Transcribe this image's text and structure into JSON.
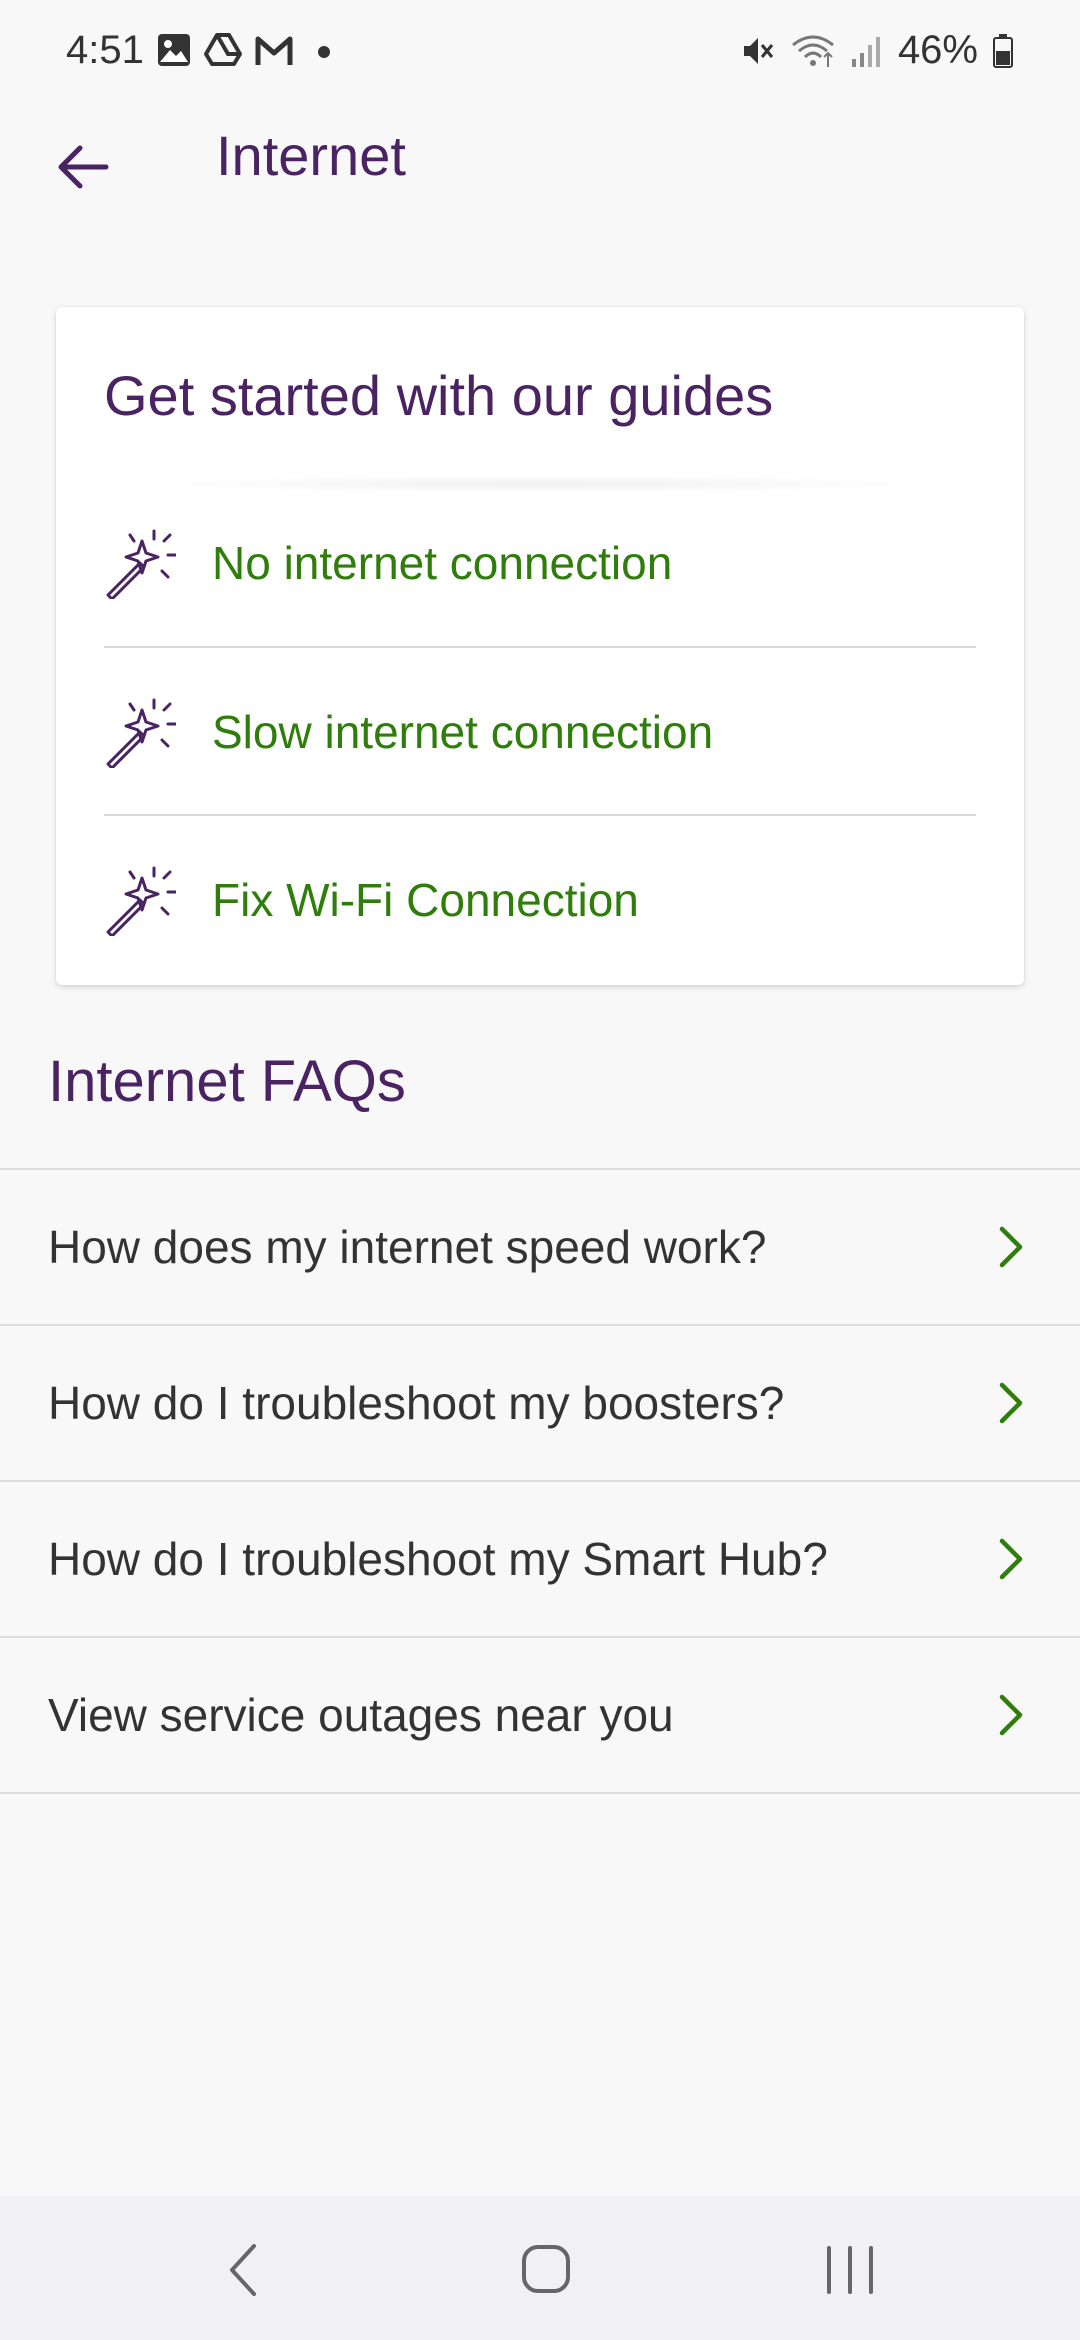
{
  "status_bar": {
    "time": "4:51",
    "battery": "46%"
  },
  "app_bar": {
    "title": "Internet"
  },
  "guides": {
    "title": "Get started with our guides",
    "items": [
      {
        "label": "No internet connection",
        "icon": "magic-wand-icon"
      },
      {
        "label": "Slow internet connection",
        "icon": "magic-wand-icon"
      },
      {
        "label": "Fix Wi-Fi Connection",
        "icon": "magic-wand-icon"
      }
    ]
  },
  "faqs": {
    "heading": "Internet FAQs",
    "items": [
      {
        "label": "How does my internet speed work?"
      },
      {
        "label": "How do I troubleshoot my boosters?"
      },
      {
        "label": "How do I troubleshoot my Smart Hub?"
      },
      {
        "label": "View service outages near you"
      }
    ]
  },
  "colors": {
    "brand_purple": "#4a2363",
    "link_green": "#2f7d0a",
    "background": "#f8f8f9"
  }
}
